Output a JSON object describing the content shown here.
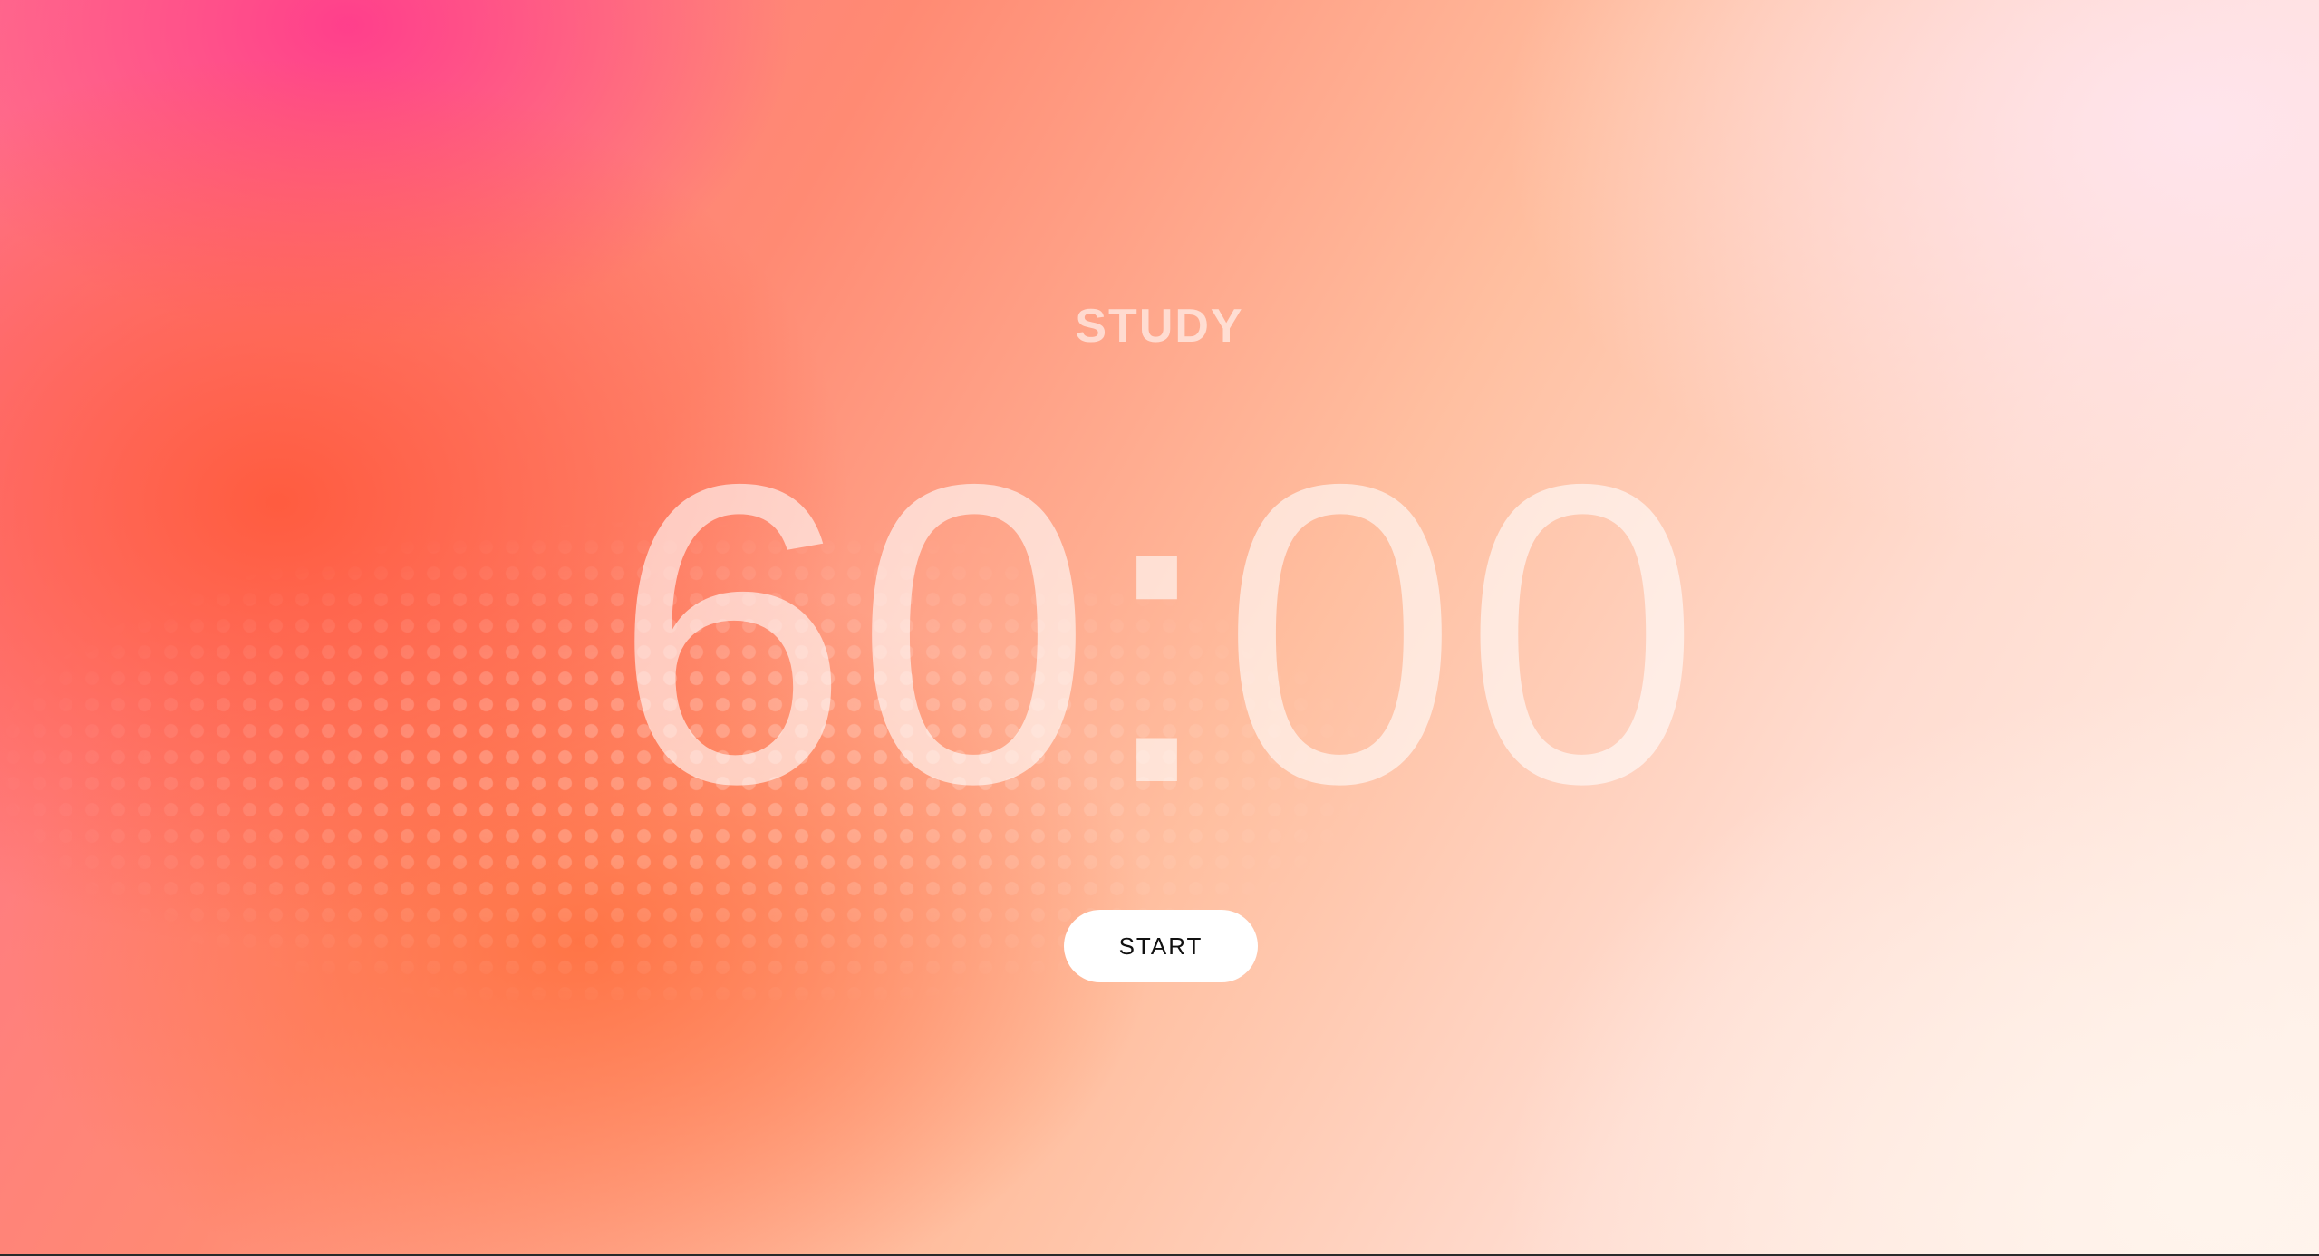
{
  "timer": {
    "mode_label": "STUDY",
    "time_display": "60:00",
    "start_label": "START"
  },
  "colors": {
    "accent_pink": "#ff3d8e",
    "accent_orange": "#ff6a45",
    "background_light": "#fff1ea",
    "button_background": "#ffffff",
    "button_text": "#111111"
  }
}
